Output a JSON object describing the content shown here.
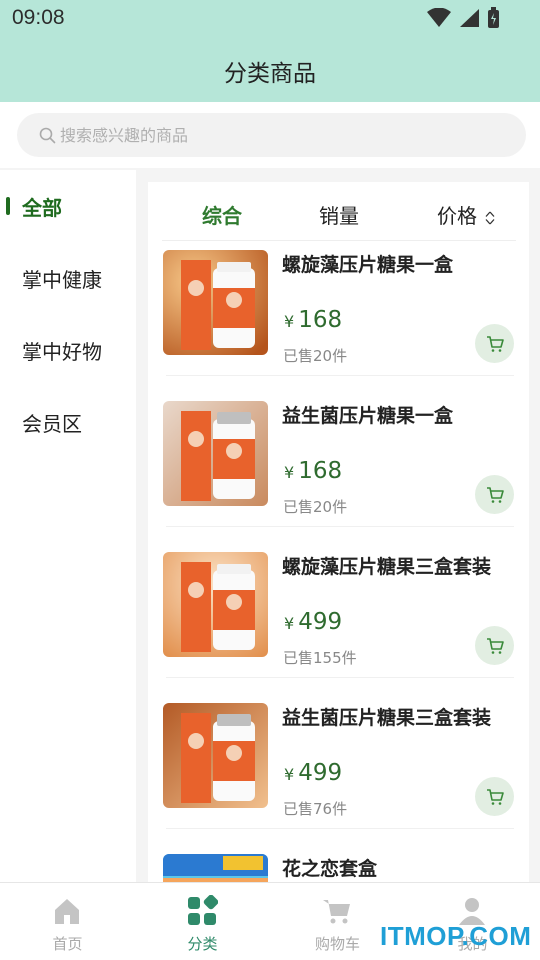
{
  "status_bar": {
    "time": "09:08"
  },
  "header": {
    "title": "分类商品"
  },
  "search": {
    "placeholder": "搜索感兴趣的商品"
  },
  "sidebar": {
    "items": [
      {
        "label": "全部",
        "active": true
      },
      {
        "label": "掌中健康",
        "active": false
      },
      {
        "label": "掌中好物",
        "active": false
      },
      {
        "label": "会员区",
        "active": false
      }
    ]
  },
  "sort": {
    "items": [
      {
        "label": "综合",
        "active": true
      },
      {
        "label": "销量",
        "active": false
      },
      {
        "label": "价格",
        "active": false
      }
    ]
  },
  "products": [
    {
      "name": "螺旋藻压片糖果一盒",
      "currency": "¥",
      "price": "168",
      "sold": "已售20件",
      "theme": "orange"
    },
    {
      "name": "益生菌压片糖果一盒",
      "currency": "¥",
      "price": "168",
      "sold": "已售20件",
      "theme": "silver"
    },
    {
      "name": "螺旋藻压片糖果三盒套装",
      "currency": "¥",
      "price": "499",
      "sold": "已售155件",
      "theme": "orange"
    },
    {
      "name": "益生菌压片糖果三盒套装",
      "currency": "¥",
      "price": "499",
      "sold": "已售76件",
      "theme": "silver"
    },
    {
      "name": "花之恋套盒",
      "currency": "",
      "price": "",
      "sold": "",
      "theme": "beach"
    }
  ],
  "tabbar": {
    "items": [
      {
        "label": "首页",
        "icon": "home-icon",
        "active": false
      },
      {
        "label": "分类",
        "icon": "category-icon",
        "active": true
      },
      {
        "label": "购物车",
        "icon": "cart-icon",
        "active": false
      },
      {
        "label": "我的",
        "icon": "user-icon",
        "active": false
      }
    ]
  },
  "watermark": {
    "text": "ITMOP.COM"
  },
  "colors": {
    "header_bg": "#b6e6d8",
    "accent_green": "#1f6b1f",
    "price_green": "#2f6b2f",
    "tab_active": "#2f8a6a",
    "watermark": "#1f9fd6"
  }
}
